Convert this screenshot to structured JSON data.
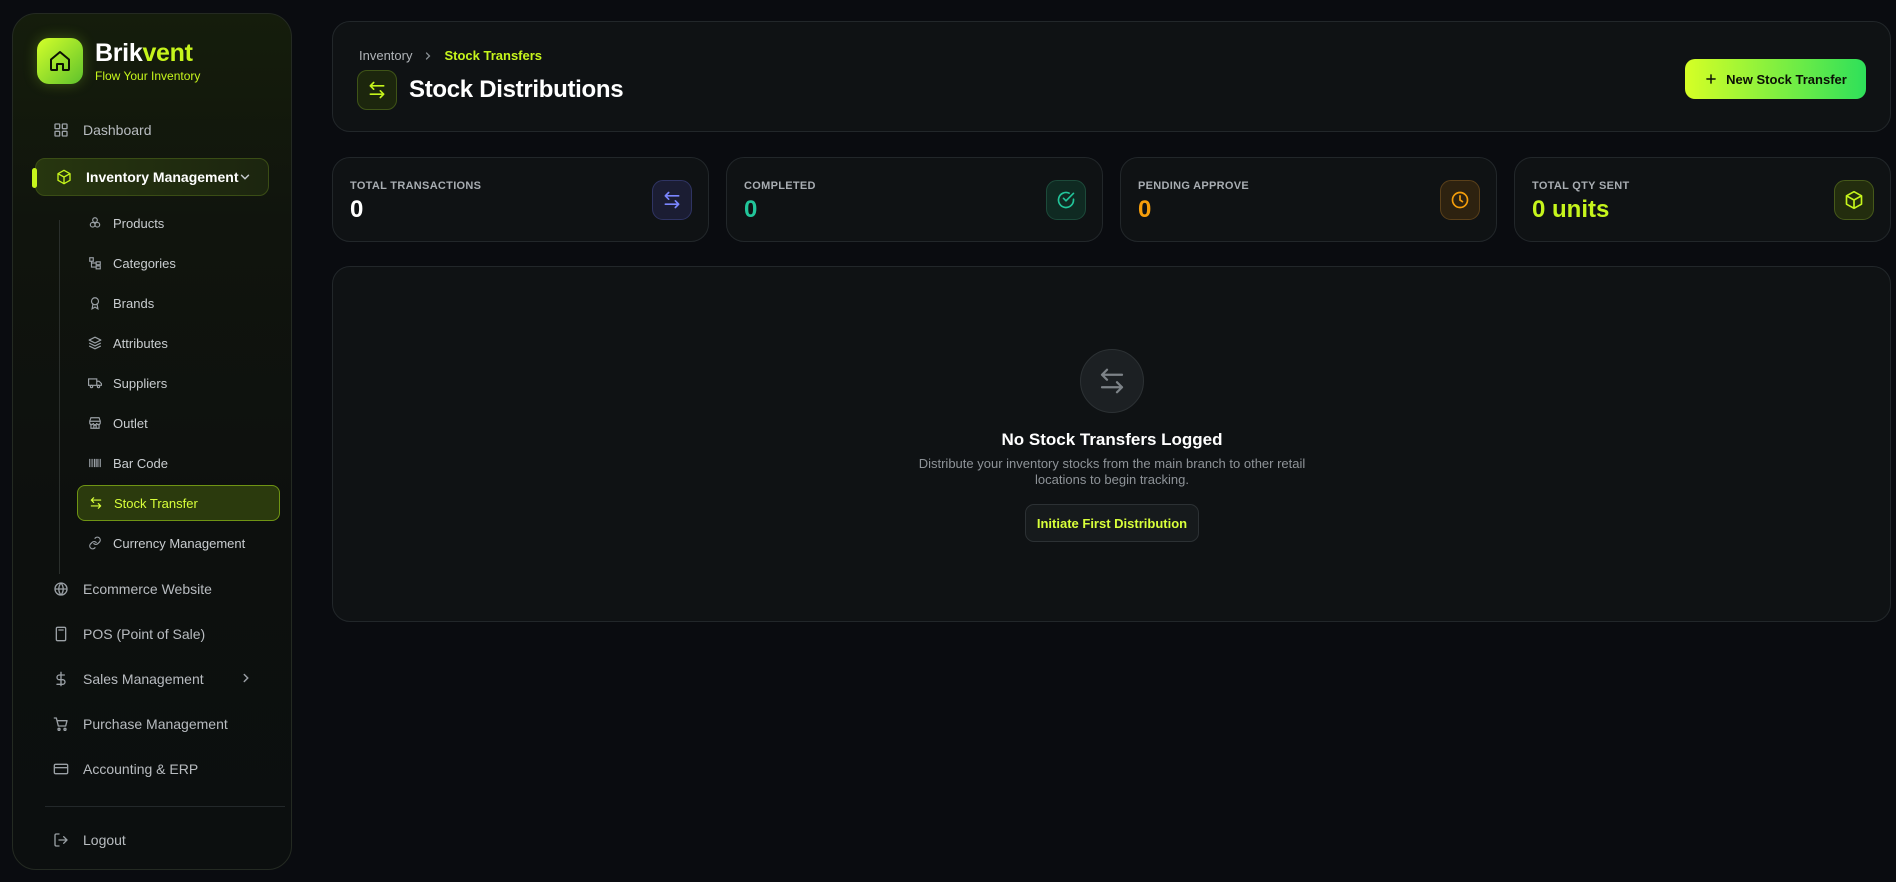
{
  "brand": {
    "name_main": "Brik",
    "name_accent": "vent",
    "tagline": "Flow Your Inventory"
  },
  "sidebar": {
    "dashboard": "Dashboard",
    "inventory": "Inventory Management",
    "sub": {
      "products": "Products",
      "categories": "Categories",
      "brands": "Brands",
      "attributes": "Attributes",
      "suppliers": "Suppliers",
      "outlet": "Outlet",
      "barcode": "Bar Code",
      "stock_transfer": "Stock Transfer",
      "currency": "Currency Management"
    },
    "ecommerce": "Ecommerce Website",
    "pos": "POS (Point of Sale)",
    "sales": "Sales Management",
    "purchase": "Purchase Management",
    "accounting": "Accounting & ERP",
    "logout": "Logout"
  },
  "header": {
    "breadcrumb_root": "Inventory",
    "breadcrumb_current": "Stock Transfers",
    "title": "Stock Distributions",
    "new_button": "New Stock Transfer"
  },
  "stats": {
    "total": {
      "label": "TOTAL TRANSACTIONS",
      "value": "0",
      "color": "#ffffff"
    },
    "completed": {
      "label": "COMPLETED",
      "value": "0",
      "color": "#22c59a"
    },
    "pending": {
      "label": "PENDING APPROVE",
      "value": "0",
      "color": "#f59e0b"
    },
    "qty": {
      "label": "TOTAL QTY SENT",
      "value": "0 units",
      "color": "#c6f51c"
    }
  },
  "empty_state": {
    "title": "No Stock Transfers Logged",
    "description": "Distribute your inventory stocks from the main branch to other retail locations to begin tracking.",
    "button": "Initiate First Distribution"
  },
  "colors": {
    "accent": "#c6f51c",
    "background": "#0a0c10",
    "card": "#0f1214"
  },
  "icons": {
    "dashboard": "grid-icon",
    "inventory": "box-icon",
    "products": "package-icon",
    "categories": "tree-icon",
    "brands": "badge-icon",
    "attributes": "layers-icon",
    "suppliers": "truck-icon",
    "outlet": "store-icon",
    "barcode": "barcode-icon",
    "stock_transfer": "transfer-icon",
    "currency": "link-icon",
    "ecommerce": "globe-icon",
    "pos": "calculator-icon",
    "sales": "dollar-icon",
    "purchase": "cart-icon",
    "accounting": "card-icon",
    "logout": "logout-icon"
  }
}
